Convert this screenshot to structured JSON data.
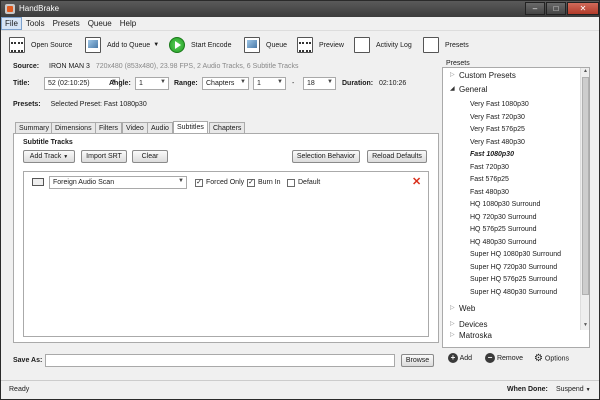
{
  "window": {
    "title": "HandBrake",
    "minimize": "–",
    "maximize": "□",
    "close": "✕"
  },
  "menu": [
    "File",
    "Tools",
    "Presets",
    "Queue",
    "Help"
  ],
  "toolbar": {
    "open_source": "Open Source",
    "add_to_queue": "Add to Queue",
    "start_encode": "Start Encode",
    "queue": "Queue",
    "preview": "Preview",
    "activity_log": "Activity Log",
    "presets": "Presets"
  },
  "source": {
    "label": "Source:",
    "name": "IRON MAN 3",
    "info": "720x480 (853x480), 23.98 FPS, 2 Audio Tracks, 6 Subtitle Tracks"
  },
  "title_row": {
    "title_label": "Title:",
    "title_value": "52 (02:10:25)",
    "angle_label": "Angle:",
    "angle_value": "1",
    "range_label": "Range:",
    "range_mode": "Chapters",
    "range_start": "1",
    "range_sep": "-",
    "range_end": "18",
    "duration_label": "Duration:",
    "duration_value": "02:10:26"
  },
  "presets_row": {
    "label": "Presets:",
    "value": "Selected Preset: Fast 1080p30"
  },
  "tabs": [
    "Summary",
    "Dimensions",
    "Filters",
    "Video",
    "Audio",
    "Subtitles",
    "Chapters"
  ],
  "active_tab": "Subtitles",
  "subtitles": {
    "heading": "Subtitle Tracks",
    "add_track": "Add Track",
    "import_srt": "Import SRT",
    "clear": "Clear",
    "selection_behavior": "Selection Behavior",
    "reload_defaults": "Reload Defaults",
    "track": {
      "source": "Foreign Audio Scan",
      "forced_only_label": "Forced Only",
      "forced_only": true,
      "burn_in_label": "Burn In",
      "burn_in": true,
      "default_label": "Default",
      "default": false
    }
  },
  "save_as": {
    "label": "Save As:",
    "value": "",
    "browse": "Browse"
  },
  "presets_panel": {
    "title": "Presets",
    "groups": [
      {
        "name": "Custom Presets",
        "expanded": false
      },
      {
        "name": "General",
        "expanded": true
      },
      {
        "name": "Web",
        "expanded": false
      },
      {
        "name": "Devices",
        "expanded": false
      },
      {
        "name": "Matroska",
        "expanded": false
      }
    ],
    "general_items": [
      "Very Fast 1080p30",
      "Very Fast 720p30",
      "Very Fast 576p25",
      "Very Fast 480p30",
      "Fast 1080p30",
      "Fast 720p30",
      "Fast 576p25",
      "Fast 480p30",
      "HQ 1080p30 Surround",
      "HQ 720p30 Surround",
      "HQ 576p25 Surround",
      "HQ 480p30 Surround",
      "Super HQ 1080p30 Surround",
      "Super HQ 720p30 Surround",
      "Super HQ 576p25 Surround",
      "Super HQ 480p30 Surround"
    ],
    "selected_item": "Fast 1080p30",
    "add": "Add",
    "remove": "Remove",
    "options": "Options"
  },
  "status": {
    "text": "Ready",
    "when_done_label": "When Done:",
    "when_done_value": "Suspend"
  },
  "colors": {
    "titlebar": "#3c3c3c",
    "start_green": "#239c23",
    "remove_red": "#d9301c",
    "selection": "#d6e4f5"
  }
}
